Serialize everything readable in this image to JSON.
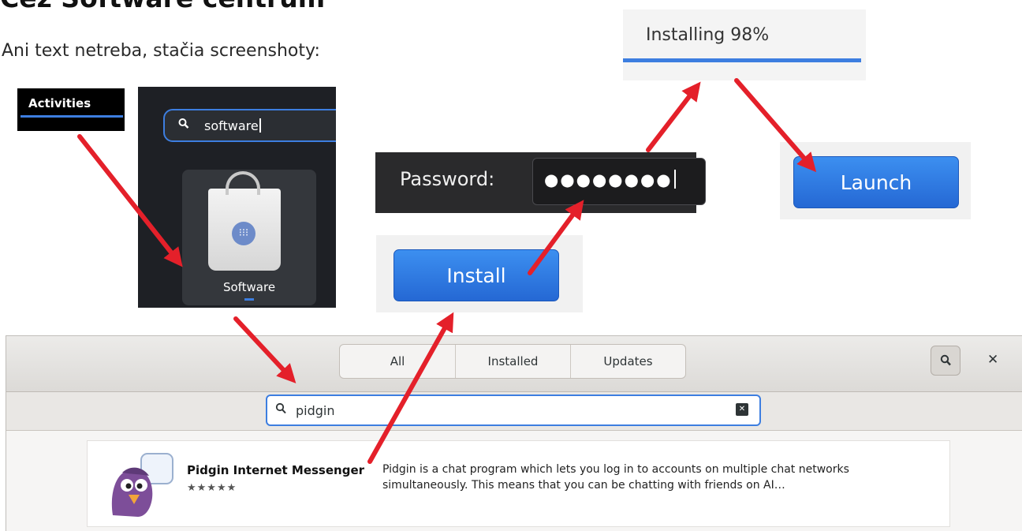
{
  "heading": "Cez Software centrum",
  "intro": "Ani text netreba, stačia screenshoty:",
  "activities": {
    "label": "Activities"
  },
  "overview": {
    "search_text": "software",
    "app_label": "Software"
  },
  "installing": {
    "label": "Installing 98%",
    "progress": 0.98
  },
  "password": {
    "label": "Password:",
    "masked_value": "●●●●●●●●"
  },
  "install_button": {
    "label": "Install"
  },
  "launch_button": {
    "label": "Launch"
  },
  "software_center": {
    "tabs": [
      {
        "label": "All"
      },
      {
        "label": "Installed"
      },
      {
        "label": "Updates"
      }
    ],
    "search": {
      "value": "pidgin"
    },
    "result": {
      "name": "Pidgin Internet Messenger",
      "rating_stars": "★★★★★",
      "description": "Pidgin is a chat program which lets you log in to accounts on multiple chat networks simultaneously.  This means that you can be chatting with friends on AI…"
    }
  },
  "colors": {
    "accent": "#3d7ee0",
    "arrow": "#e4202a"
  }
}
